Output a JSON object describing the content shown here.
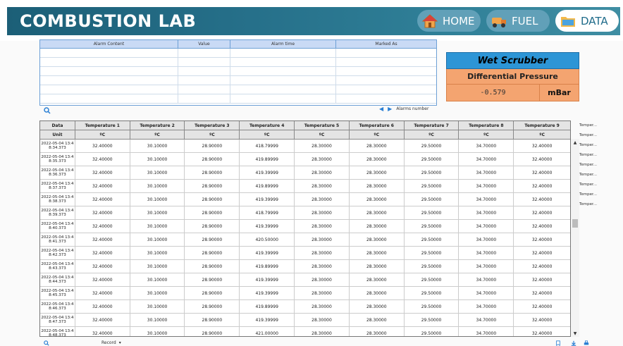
{
  "app": {
    "title": "COMBUSTION LAB"
  },
  "nav": [
    {
      "label": "HOME",
      "icon": "home-icon"
    },
    {
      "label": "FUEL",
      "icon": "fuel-truck-icon"
    },
    {
      "label": "DATA",
      "icon": "folder-icon"
    }
  ],
  "alarm": {
    "columns": [
      "Alarm Content",
      "Value",
      "Alarm time",
      "Marked As"
    ],
    "nav_label": "Alarms number"
  },
  "scrubber": {
    "title": "Wet Scrubber",
    "subtitle": "Differential Pressure",
    "value": "-0.579",
    "unit": "mBar"
  },
  "table": {
    "columns": [
      "Data",
      "Temperature 1",
      "Temperature 2",
      "Temperature 3",
      "Temperature 4",
      "Temperature 5",
      "Temperature 6",
      "Temperature 7",
      "Temperature 8",
      "Temperature 9"
    ],
    "units": [
      "Unit",
      "ºC",
      "ºC",
      "ºC",
      "ºC",
      "ºC",
      "ºC",
      "ºC",
      "ºC",
      "ºC"
    ],
    "rows": [
      {
        "t": [
          "2022-05-04 13:4",
          "8:34.373"
        ],
        "v": [
          "32.40000",
          "30.10000",
          "28.90000",
          "418.79999",
          "28.30000",
          "28.30000",
          "29.50000",
          "34.70000",
          "32.40000"
        ]
      },
      {
        "t": [
          "2022-05-04 13:4",
          "8:35.373"
        ],
        "v": [
          "32.40000",
          "30.10000",
          "28.90000",
          "419.89999",
          "28.30000",
          "28.30000",
          "29.50000",
          "34.70000",
          "32.40000"
        ]
      },
      {
        "t": [
          "2022-05-04 13:4",
          "8:36.373"
        ],
        "v": [
          "32.40000",
          "30.10000",
          "28.90000",
          "419.39999",
          "28.30000",
          "28.30000",
          "29.50000",
          "34.70000",
          "32.40000"
        ]
      },
      {
        "t": [
          "2022-05-04 13:4",
          "8:37.373"
        ],
        "v": [
          "32.40000",
          "30.10000",
          "28.90000",
          "419.89999",
          "28.30000",
          "28.30000",
          "29.50000",
          "34.70000",
          "32.40000"
        ]
      },
      {
        "t": [
          "2022-05-04 13:4",
          "8:38.373"
        ],
        "v": [
          "32.40000",
          "30.10000",
          "28.90000",
          "419.39999",
          "28.30000",
          "28.30000",
          "29.50000",
          "34.70000",
          "32.40000"
        ]
      },
      {
        "t": [
          "2022-05-04 13:4",
          "8:39.373"
        ],
        "v": [
          "32.40000",
          "30.10000",
          "28.90000",
          "418.79999",
          "28.30000",
          "28.30000",
          "29.50000",
          "34.70000",
          "32.40000"
        ]
      },
      {
        "t": [
          "2022-05-04 13:4",
          "8:40.373"
        ],
        "v": [
          "32.40000",
          "30.10000",
          "28.90000",
          "419.39999",
          "28.30000",
          "28.30000",
          "29.50000",
          "34.70000",
          "32.40000"
        ]
      },
      {
        "t": [
          "2022-05-04 13:4",
          "8:41.373"
        ],
        "v": [
          "32.40000",
          "30.10000",
          "28.90000",
          "420.50000",
          "28.30000",
          "28.30000",
          "29.50000",
          "34.70000",
          "32.40000"
        ]
      },
      {
        "t": [
          "2022-05-04 13:4",
          "8:42.373"
        ],
        "v": [
          "32.40000",
          "30.10000",
          "28.90000",
          "419.39999",
          "28.30000",
          "28.30000",
          "29.50000",
          "34.70000",
          "32.40000"
        ]
      },
      {
        "t": [
          "2022-05-04 13:4",
          "8:43.373"
        ],
        "v": [
          "32.40000",
          "30.10000",
          "28.90000",
          "419.89999",
          "28.30000",
          "28.30000",
          "29.50000",
          "34.70000",
          "32.40000"
        ]
      },
      {
        "t": [
          "2022-05-04 13:4",
          "8:44.373"
        ],
        "v": [
          "32.40000",
          "30.10000",
          "28.90000",
          "419.39999",
          "28.30000",
          "28.30000",
          "29.50000",
          "34.70000",
          "32.40000"
        ]
      },
      {
        "t": [
          "2022-05-04 13:4",
          "8:45.373"
        ],
        "v": [
          "32.40000",
          "30.10000",
          "28.90000",
          "419.39999",
          "28.30000",
          "28.30000",
          "29.50000",
          "34.70000",
          "32.40000"
        ]
      },
      {
        "t": [
          "2022-05-04 13:4",
          "8:46.373"
        ],
        "v": [
          "32.40000",
          "30.10000",
          "28.90000",
          "419.89999",
          "28.30000",
          "28.30000",
          "29.50000",
          "34.70000",
          "32.40000"
        ]
      },
      {
        "t": [
          "2022-05-04 13:4",
          "8:47.373"
        ],
        "v": [
          "32.40000",
          "30.10000",
          "28.90000",
          "419.39999",
          "28.30000",
          "28.30000",
          "29.50000",
          "34.70000",
          "32.40000"
        ]
      },
      {
        "t": [
          "2022-05-04 13:4",
          "8:48.373"
        ],
        "v": [
          "32.40000",
          "30.10000",
          "28.90000",
          "421.00000",
          "28.30000",
          "28.30000",
          "29.50000",
          "34.70000",
          "32.40000"
        ]
      }
    ]
  },
  "legend": [
    "Temper...",
    "Temper...",
    "Temper...",
    "Temper...",
    "Temper...",
    "Temper...",
    "Temper...",
    "Temper...",
    "Temper..."
  ],
  "footer": {
    "record_label": "Record"
  },
  "colors": {
    "banner": "#26708a",
    "scrubber_title": "#2d95d6",
    "scrubber_body": "#f4a470",
    "alarm_header": "#c9daf5"
  }
}
